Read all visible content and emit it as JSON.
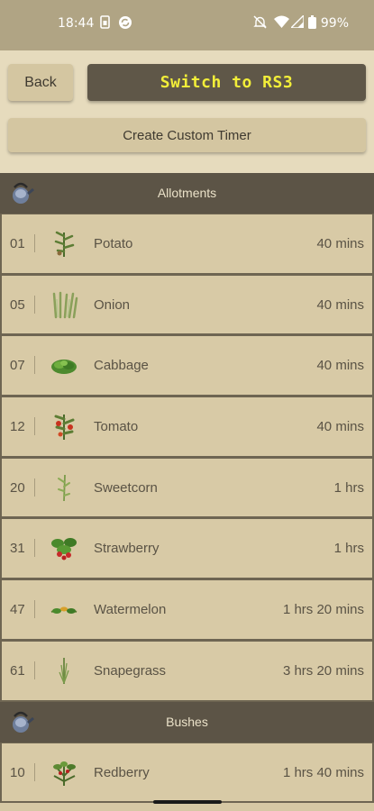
{
  "status_bar": {
    "time": "18:44",
    "battery": "99%",
    "icons": [
      "sim-icon",
      "sync-icon",
      "mute-icon",
      "wifi-icon",
      "signal-icon",
      "battery-icon"
    ]
  },
  "toolbar": {
    "back_label": "Back",
    "switch_label": "Switch to RS3",
    "custom_timer_label": "Create Custom Timer"
  },
  "colors": {
    "background": "#d6c8a4",
    "header": "#5c5446",
    "switch_text": "#f2ee39",
    "status_bar": "#b0a484"
  },
  "sections": [
    {
      "title": "Allotments",
      "icon": "watering-can-icon",
      "items": [
        {
          "level": "01",
          "name": "Potato",
          "time": "40 mins",
          "icon": "potato-plant-icon"
        },
        {
          "level": "05",
          "name": "Onion",
          "time": "40 mins",
          "icon": "onion-plant-icon"
        },
        {
          "level": "07",
          "name": "Cabbage",
          "time": "40 mins",
          "icon": "cabbage-plant-icon"
        },
        {
          "level": "12",
          "name": "Tomato",
          "time": "40 mins",
          "icon": "tomato-plant-icon"
        },
        {
          "level": "20",
          "name": "Sweetcorn",
          "time": "1 hrs",
          "icon": "sweetcorn-plant-icon"
        },
        {
          "level": "31",
          "name": "Strawberry",
          "time": "1 hrs",
          "icon": "strawberry-plant-icon"
        },
        {
          "level": "47",
          "name": "Watermelon",
          "time": "1 hrs 20 mins",
          "icon": "watermelon-plant-icon"
        },
        {
          "level": "61",
          "name": "Snapegrass",
          "time": "3 hrs 20 mins",
          "icon": "snapegrass-plant-icon"
        }
      ]
    },
    {
      "title": "Bushes",
      "icon": "watering-can-icon",
      "items": [
        {
          "level": "10",
          "name": "Redberry",
          "time": "1 hrs 40 mins",
          "icon": "redberry-bush-icon"
        }
      ]
    }
  ]
}
